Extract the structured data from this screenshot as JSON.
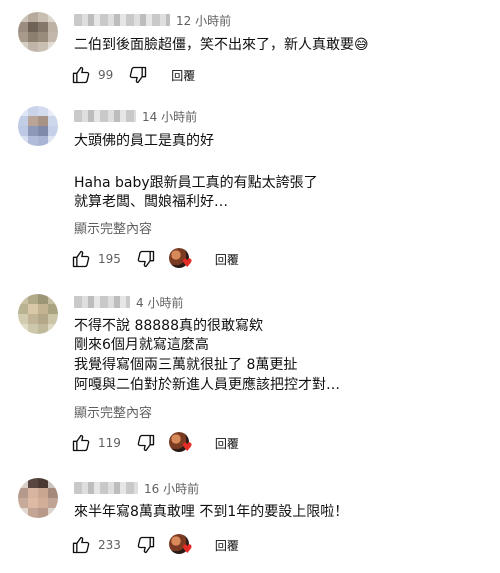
{
  "comments": [
    {
      "time": "12 小時前",
      "lines": [
        "二伯到後面臉超僵，笑不出來了，新人真敢要😅"
      ],
      "more": "",
      "likes": "99",
      "reply": "回覆",
      "creator_heart": false
    },
    {
      "time": "14 小時前",
      "lines": [
        "大頭佛的員工是真的好",
        "",
        "Haha baby跟新員工真的有點太誇張了",
        "就算老闆、闆娘福利好…"
      ],
      "more": "顯示完整內容",
      "likes": "195",
      "reply": "回覆",
      "creator_heart": true
    },
    {
      "time": "4 小時前",
      "lines": [
        "不得不說  88888真的很敢寫欸",
        "剛來6個月就寫這麼高",
        "我覺得寫個兩三萬就很扯了  8萬更扯",
        "阿嘎與二伯對於新進人員更應該把控才對…"
      ],
      "more": "顯示完整內容",
      "likes": "119",
      "reply": "回覆",
      "creator_heart": true
    },
    {
      "time": "16 小時前",
      "lines": [
        "來半年寫8萬真敢哩  不到1年的要設上限啦！"
      ],
      "more": "",
      "likes": "233",
      "reply": "回覆",
      "creator_heart": true
    }
  ],
  "icons": {
    "like": "thumbs-up-icon",
    "dislike": "thumbs-down-icon",
    "heart": "heart-icon"
  },
  "colors": {
    "text": "#0f0f0f",
    "secondary": "#606060",
    "heart": "#e52d27"
  }
}
